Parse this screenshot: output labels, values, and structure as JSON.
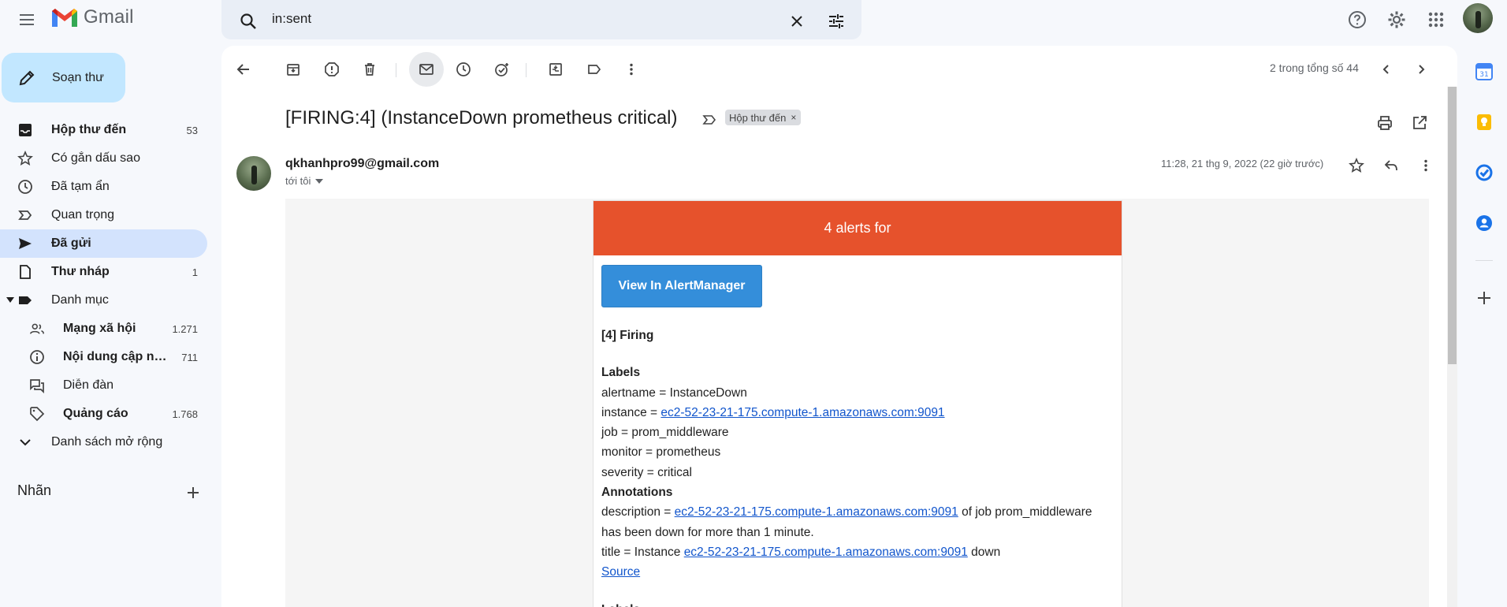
{
  "header": {
    "app_name": "Gmail",
    "search_value": "in:sent"
  },
  "compose": {
    "label": "Soạn thư"
  },
  "sidebar": {
    "items": [
      {
        "label": "Hộp thư đến",
        "count": "53"
      },
      {
        "label": "Có gắn dấu sao",
        "count": ""
      },
      {
        "label": "Đã tạm ẩn",
        "count": ""
      },
      {
        "label": "Quan trọng",
        "count": ""
      },
      {
        "label": "Đã gửi",
        "count": ""
      },
      {
        "label": "Thư nháp",
        "count": "1"
      },
      {
        "label": "Danh mục",
        "count": ""
      },
      {
        "label": "Mạng xã hội",
        "count": "1.271"
      },
      {
        "label": "Nội dung cập nhật",
        "count": "711"
      },
      {
        "label": "Diễn đàn",
        "count": ""
      },
      {
        "label": "Quảng cáo",
        "count": "1.768"
      },
      {
        "label": "Danh sách mở rộng",
        "count": ""
      }
    ],
    "labels_heading": "Nhãn"
  },
  "toolbar": {
    "pager": "2 trong tổng số 44"
  },
  "message": {
    "subject": "[FIRING:4] (InstanceDown prometheus critical)",
    "label_chip": "Hộp thư đến",
    "sender": "qkhanhpro99@gmail.com",
    "to": "tới tôi",
    "date": "11:28, 21 thg 9, 2022 (22 giờ trước)"
  },
  "alert": {
    "header": "4 alerts for",
    "button": "View In AlertManager",
    "firing_title": "[4] Firing",
    "labels_title": "Labels",
    "alertname": "alertname = InstanceDown",
    "instance_prefix": "instance = ",
    "instance_link": "ec2-52-23-21-175.compute-1.amazonaws.com:9091",
    "job": "job = prom_middleware",
    "monitor": "monitor = prometheus",
    "severity": "severity = critical",
    "annotations_title": "Annotations",
    "description_prefix": "description = ",
    "description_link": "ec2-52-23-21-175.compute-1.amazonaws.com:9091",
    "description_suffix": " of job prom_middleware",
    "description_line2": "has been down for more than 1 minute.",
    "title_prefix": "title = Instance ",
    "title_link": "ec2-52-23-21-175.compute-1.amazonaws.com:9091",
    "title_suffix": " down",
    "source": "Source",
    "next_labels_title": "Labels"
  },
  "colors": {
    "alert_header": "#e6522c",
    "alert_button": "#348eda",
    "active_nav": "#d3e3fd",
    "compose_bg": "#c2e7ff"
  }
}
